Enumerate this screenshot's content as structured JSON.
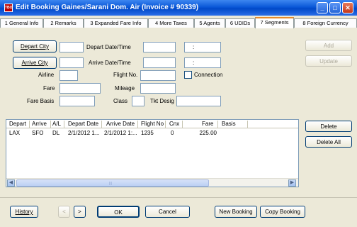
{
  "window": {
    "app_icon_text": "TBO",
    "title": "Edit Booking Gaines/Sarani  Dom. Air (Invoice # 90339)",
    "controls": {
      "minimize": "_",
      "maximize": "□",
      "close": "✕"
    }
  },
  "tabs": [
    {
      "label": "1 General Info"
    },
    {
      "label": "2 Remarks"
    },
    {
      "label": "3 Expanded Fare Info"
    },
    {
      "label": "4 More Taxes"
    },
    {
      "label": "5 Agents"
    },
    {
      "label": "6 UDIDs"
    },
    {
      "label": "7 Segments"
    },
    {
      "label": "8 Foreign Currency"
    }
  ],
  "active_tab": "7 Segments",
  "form": {
    "depart_city_button": "Depart City",
    "arrive_city_button": "Arrive City",
    "depart_datetime_label": "Depart Date/Time",
    "arrive_datetime_label": "Arrive Date/Time",
    "time_separator": ":",
    "airline_label": "Airline",
    "flight_no_label": "Flight No.",
    "connection_label": "Connection",
    "fare_label": "Fare",
    "mileage_label": "Mileage",
    "fare_basis_label": "Fare Basis",
    "class_label": "Class",
    "tkt_desig_label": "Tkt Desig"
  },
  "side_buttons": {
    "add": "Add",
    "update": "Update",
    "delete": "Delete",
    "delete_all": "Delete All"
  },
  "grid": {
    "columns": [
      "Depart",
      "Arrive",
      "A/L",
      "Depart Date",
      "Arrive Date",
      "Flight No",
      "Cnx",
      "Fare",
      "Basis"
    ],
    "rows": [
      {
        "depart": "LAX",
        "arrive": "SFO",
        "airline": "DL",
        "depart_date": "2/1/2012 1...",
        "arrive_date": "2/1/2012 1:...",
        "flight_no": "1235",
        "cnx": "0",
        "fare": "225.00",
        "basis": ""
      }
    ]
  },
  "footer": {
    "history": "History",
    "prev": "<",
    "next": ">",
    "ok": "OK",
    "cancel": "Cancel",
    "new_booking": "New Booking",
    "copy_booking": "Copy Booking"
  }
}
